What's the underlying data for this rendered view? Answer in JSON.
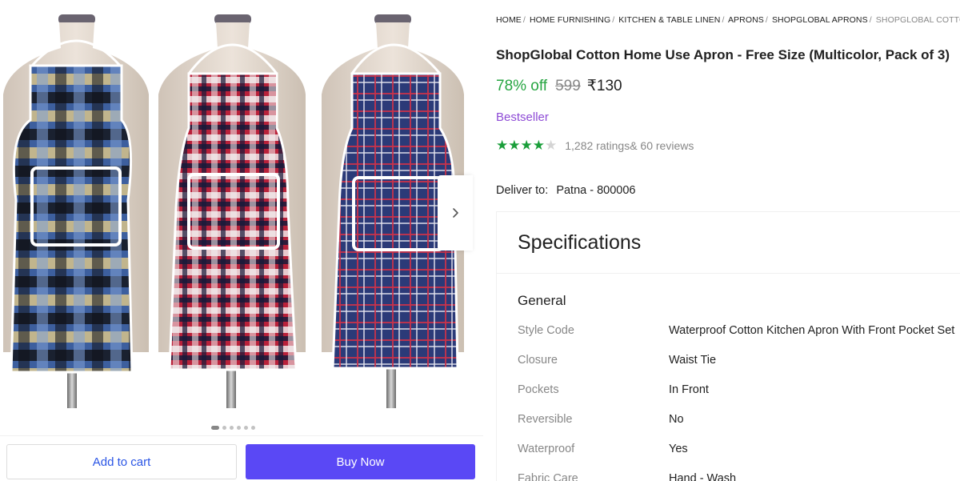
{
  "breadcrumb": [
    "HOME",
    "HOME FURNISHING",
    "KITCHEN & TABLE LINEN",
    "APRONS",
    "SHOPGLOBAL APRONS",
    "SHOPGLOBAL COTTO"
  ],
  "product": {
    "title": "ShopGlobal Cotton Home Use Apron - Free Size (Multicolor, Pack of 3)",
    "discount": "78% off",
    "mrp": "599",
    "price": "₹130",
    "badge": "Bestseller",
    "rating_stars": 4,
    "ratings_text": "1,282 ratings",
    "reviews_text": "& 60 reviews"
  },
  "delivery": {
    "label": "Deliver to:",
    "location": "Patna - 800006"
  },
  "gallery": {
    "image_count": 6,
    "active_index": 0
  },
  "actions": {
    "add_to_cart": "Add to cart",
    "buy_now": "Buy Now"
  },
  "specifications": {
    "title": "Specifications",
    "section": "General",
    "rows": [
      {
        "key": "Style Code",
        "value": "Waterproof Cotton Kitchen Apron With Front Pocket Set"
      },
      {
        "key": "Closure",
        "value": "Waist Tie"
      },
      {
        "key": "Pockets",
        "value": "In Front"
      },
      {
        "key": "Reversible",
        "value": "No"
      },
      {
        "key": "Waterproof",
        "value": "Yes"
      },
      {
        "key": "Fabric Care",
        "value": "Hand - Wash"
      }
    ]
  },
  "colors": {
    "accent_blue": "#2a55e5",
    "buy_button": "#5a48f5",
    "discount_green": "#26a541",
    "star_green": "#1a9e3a",
    "bestseller_purple": "#8e4bd6"
  },
  "icons": {
    "carousel_next": "chevron-right-icon",
    "rating": "star-icon"
  }
}
